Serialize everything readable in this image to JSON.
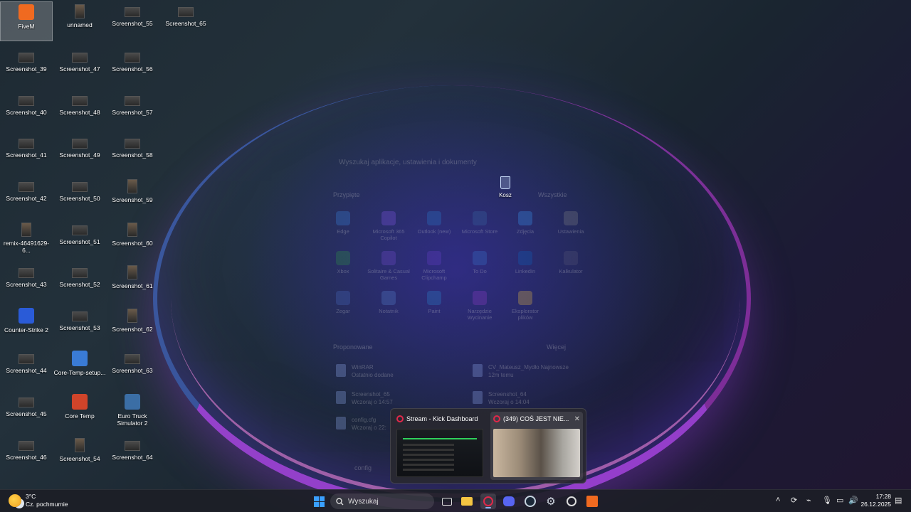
{
  "desktop": {
    "icons": [
      {
        "label": "FiveM"
      },
      {
        "label": "unnamed"
      },
      {
        "label": "Screenshot_55"
      },
      {
        "label": "Screenshot_65"
      },
      {
        "label": "Screenshot_39"
      },
      {
        "label": "Screenshot_47"
      },
      {
        "label": "Screenshot_56"
      },
      {
        "label": "Screenshot_40"
      },
      {
        "label": "Screenshot_48"
      },
      {
        "label": "Screenshot_57"
      },
      {
        "label": "Screenshot_41"
      },
      {
        "label": "Screenshot_49"
      },
      {
        "label": "Screenshot_58"
      },
      {
        "label": "Screenshot_42"
      },
      {
        "label": "Screenshot_50"
      },
      {
        "label": "Screenshot_59"
      },
      {
        "label": "remix-46491629-6..."
      },
      {
        "label": "Screenshot_51"
      },
      {
        "label": "Screenshot_60"
      },
      {
        "label": "Screenshot_43"
      },
      {
        "label": "Screenshot_52"
      },
      {
        "label": "Screenshot_61"
      },
      {
        "label": "Counter-Strike 2"
      },
      {
        "label": "Screenshot_53"
      },
      {
        "label": "Screenshot_62"
      },
      {
        "label": "Screenshot_44"
      },
      {
        "label": "Core-Temp-setup..."
      },
      {
        "label": "Screenshot_63"
      },
      {
        "label": "Screenshot_45"
      },
      {
        "label": "Core Temp"
      },
      {
        "label": "Euro Truck Simulator 2"
      },
      {
        "label": "Screenshot_46"
      },
      {
        "label": "Screenshot_54"
      },
      {
        "label": "Screenshot_64"
      }
    ],
    "recycle_bin": "Kosz"
  },
  "start_menu_ghost": {
    "search_placeholder": "Wyszukaj aplikacje, ustawienia i dokumenty",
    "pinned_title": "Przypięte",
    "all_label": "Wszystkie",
    "pinned": [
      {
        "label": "Edge"
      },
      {
        "label": "Microsoft 365 Copilot"
      },
      {
        "label": "Outlook (new)"
      },
      {
        "label": "Microsoft Store"
      },
      {
        "label": "Zdjęcia"
      },
      {
        "label": "Ustawienia"
      },
      {
        "label": "Xbox"
      },
      {
        "label": "Solitaire & Casual Games"
      },
      {
        "label": "Microsoft Clipchamp"
      },
      {
        "label": "To Do"
      },
      {
        "label": "LinkedIn"
      },
      {
        "label": "Kalkulator"
      },
      {
        "label": "Zegar"
      },
      {
        "label": "Notatnik"
      },
      {
        "label": "Paint"
      },
      {
        "label": "Narzędzie Wycinanie"
      },
      {
        "label": "Eksplorator plików"
      }
    ],
    "recommended_title": "Proponowane",
    "more_label": "Więcej",
    "recommended": [
      {
        "name": "WinRAR",
        "sub": "Ostatnio dodane"
      },
      {
        "name": "CV_Mateusz_Mydło Najnowsze",
        "sub": "12m temu"
      },
      {
        "name": "Screenshot_65",
        "sub": "Wczoraj o 14:57"
      },
      {
        "name": "Screenshot_64",
        "sub": "Wczoraj o 14:04"
      },
      {
        "name": "config.cfg",
        "sub": "Wczoraj o 22:"
      }
    ],
    "user": "config"
  },
  "preview": {
    "items": [
      {
        "title": "Stream - Kick Dashboard"
      },
      {
        "title": "(349) COŚ JEST NIE..."
      }
    ],
    "close_glyph": "✕"
  },
  "taskbar": {
    "weather_temp": "3°C",
    "weather_desc": "Cz. pochmurnie",
    "search_label": "Wyszukaj",
    "time": "17:28",
    "date": "26.12.2025",
    "accent": "#3aa0ff"
  }
}
